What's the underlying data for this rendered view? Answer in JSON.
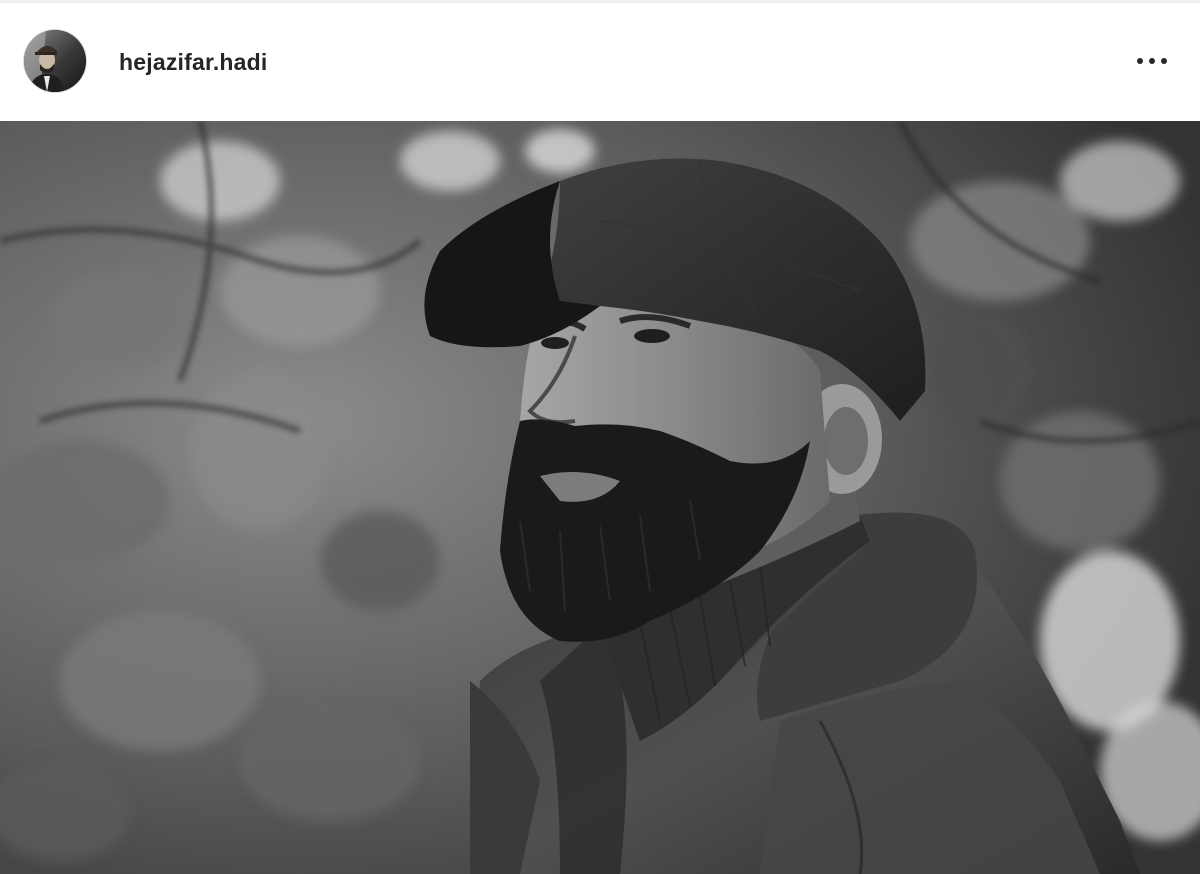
{
  "post": {
    "header": {
      "username": "hejazifar.hadi",
      "more_icon": "more-horizontal-icon",
      "avatar_icon": "profile-avatar"
    },
    "media": {
      "type": "photo",
      "style": "black-and-white"
    }
  },
  "colors": {
    "username_text": "#262626",
    "header_bg": "#ffffff",
    "divider": "#efefef"
  }
}
